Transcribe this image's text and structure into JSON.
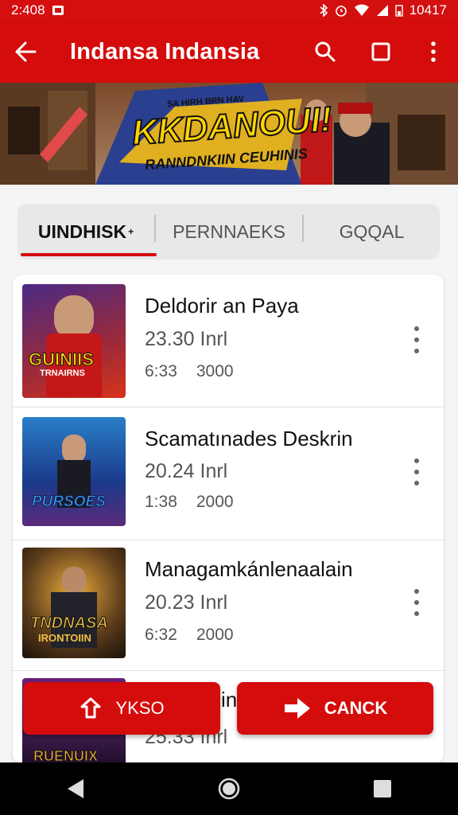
{
  "status_bar": {
    "time": "2:408",
    "battery": "10417"
  },
  "app_bar": {
    "title": "Indansa Indansia"
  },
  "banner": {
    "headline": "KKDANOUI!",
    "tagline": "RANNDNKIIN CEUHINIS",
    "small_text": "SA HIRH BRN HAV"
  },
  "tabs": [
    {
      "label": "UINDHISK",
      "active": true
    },
    {
      "label": "PERNNAEKS",
      "active": false
    },
    {
      "label": "GQQAL",
      "active": false
    }
  ],
  "items": [
    {
      "title": "Deldorir an Paya",
      "subtitle": "23.30  Inrl",
      "meta1": "6:33",
      "meta2": "3000",
      "thumb_text": "GUINIIS",
      "thumb_sub": "TRNAIRNS",
      "thumb_colors": [
        "#6b2b8f",
        "#d8331a"
      ]
    },
    {
      "title": "Scamatınades Deskrin",
      "subtitle": "20.24  Inrl",
      "meta1": "1:38",
      "meta2": "2000",
      "thumb_text": "PURSOES",
      "thumb_sub": "",
      "thumb_colors": [
        "#1b4a9a",
        "#3aa0d8"
      ]
    },
    {
      "title": "Managamkánlenaalain",
      "subtitle": "20.23  Inrl",
      "meta1": "6:32",
      "meta2": "2000",
      "thumb_text": "TNDNASA",
      "thumb_sub": "IRONTOIIN",
      "thumb_colors": [
        "#3a2a1a",
        "#c9862a"
      ]
    },
    {
      "title": "inl",
      "subtitle": "25.33  Inrl",
      "meta1": "",
      "meta2": "",
      "thumb_text": "RUENUIX",
      "thumb_sub": "",
      "thumb_colors": [
        "#5a1f6a",
        "#d4a030"
      ]
    }
  ],
  "buttons": {
    "left": {
      "label": "YKSO",
      "icon": "upload-icon"
    },
    "right": {
      "label": "CANCK",
      "icon": "arrow-right-icon"
    }
  },
  "colors": {
    "primary": "#d50c0c",
    "background": "#f4f4f4"
  }
}
